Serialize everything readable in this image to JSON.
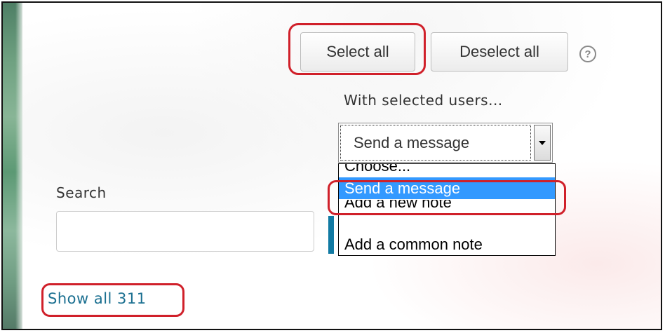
{
  "toolbar": {
    "select_all_label": "Select all",
    "deselect_all_label": "Deselect all",
    "help_icon": "question-circle-icon",
    "help_glyph": "?"
  },
  "bulk_action": {
    "label": "With selected users...",
    "selected_value": "Send a message",
    "options": [
      {
        "label": "Choose...",
        "highlighted": false
      },
      {
        "label": "Send a message",
        "highlighted": true
      },
      {
        "label": "Add a new note",
        "highlighted": false
      },
      {
        "label": "Add a common note",
        "highlighted": false
      }
    ]
  },
  "search": {
    "label": "Search",
    "value": "",
    "placeholder": ""
  },
  "show_all": {
    "label": "Show all 311"
  },
  "colors": {
    "highlight": "#3399ff",
    "link": "#1a6f90",
    "annotation_ring": "#d0202a",
    "accent_strip": "#117aa3"
  }
}
